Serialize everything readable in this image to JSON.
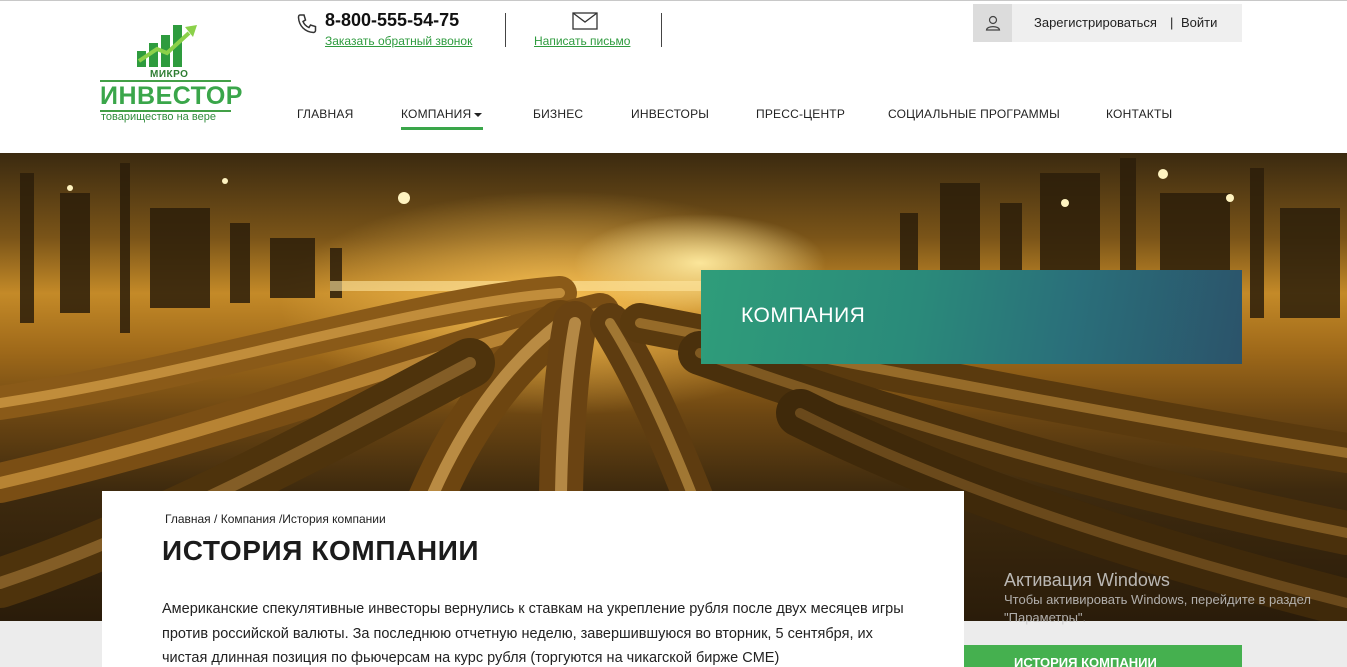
{
  "header": {
    "logo": {
      "small": "МИКРО",
      "big": "ИНВЕСТОР",
      "tagline": "товарищество на вере"
    },
    "phone": {
      "icon": "phone-icon",
      "number": "8-800-555-54-75",
      "callback_label": "Заказать обратный звонок"
    },
    "mail": {
      "icon": "envelope-icon",
      "label": "Написать письмо"
    },
    "auth": {
      "icon": "user-icon",
      "register_label": "Зарегистрироваться",
      "divider": "|",
      "login_label": "Войти"
    },
    "nav": [
      {
        "label": "ГЛАВНАЯ"
      },
      {
        "label": "КОМПАНИЯ",
        "active": true
      },
      {
        "label": "БИЗНЕС"
      },
      {
        "label": "ИНВЕСТОРЫ"
      },
      {
        "label": "ПРЕСС-ЦЕНТР"
      },
      {
        "label": "СОЦИАЛЬНЫЕ ПРОГРАММЫ"
      },
      {
        "label": "КОНТАКТЫ"
      }
    ]
  },
  "hero": {
    "banner_title": "КОМПАНИЯ"
  },
  "content": {
    "breadcrumb": {
      "home": "Главная",
      "sep1": " / ",
      "company": "Компания",
      "sep2": " /",
      "current": "История компании"
    },
    "title": "ИСТОРИЯ КОМПАНИИ",
    "paragraph": "Американские спекулятивные инвесторы вернулись к ставкам на укрепление рубля после двух месяцев игры против российской валюты. За последнюю отчетную неделю, завершившуюся во вторник, 5 сентября, их чистая длинная позиция по фьючерсам на курс рубля (торгуются на чикагской бирже CME)"
  },
  "sidebar": {
    "tab_label": "ИСТОРИЯ КОМПАНИИ"
  },
  "windows_overlay": {
    "title": "Активация Windows",
    "text": "Чтобы активировать Windows, перейдите в раздел \"Параметры\"."
  },
  "colors": {
    "brand_green": "#3aa64a",
    "banner_start": "#2f9d7a",
    "banner_end": "#2b536a"
  }
}
